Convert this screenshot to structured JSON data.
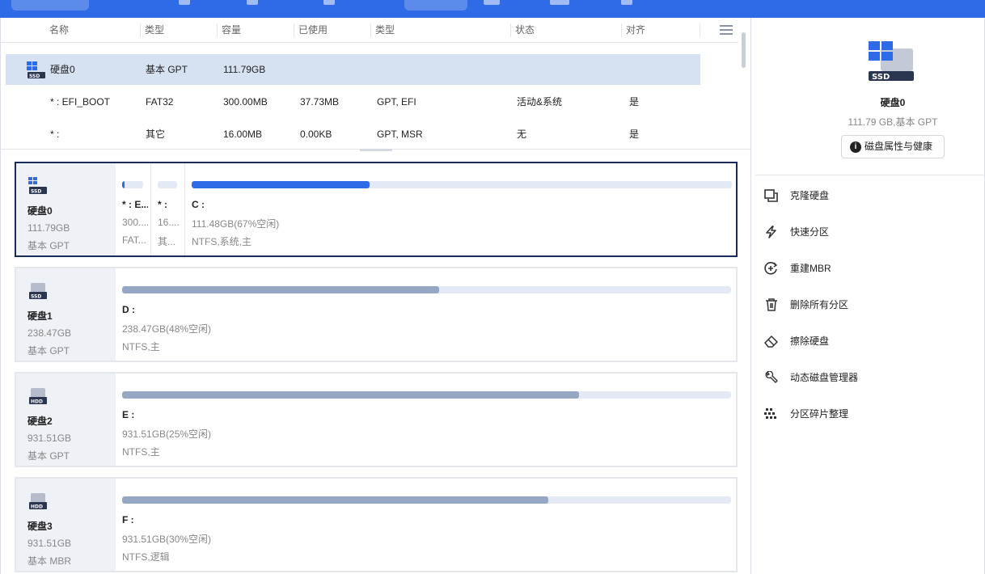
{
  "table": {
    "headers": [
      "名称",
      "类型",
      "容量",
      "已使用",
      "类型",
      "状态",
      "对齐"
    ],
    "rows": [
      {
        "name": "硬盘0",
        "type": "基本 GPT",
        "capacity": "111.79GB",
        "used": "",
        "fstype": "",
        "status": "",
        "align": ""
      },
      {
        "name": "* : EFI_BOOT",
        "type": "FAT32",
        "capacity": "300.00MB",
        "used": "37.73MB",
        "fstype": "GPT, EFI",
        "status": "活动&系统",
        "align": "是"
      },
      {
        "name": "* :",
        "type": "其它",
        "capacity": "16.00MB",
        "used": "0.00KB",
        "fstype": "GPT, MSR",
        "status": "无",
        "align": "是"
      }
    ]
  },
  "disks": [
    {
      "name": "硬盘0",
      "size": "111.79GB",
      "type": "基本 GPT",
      "icon": "ssd-icon",
      "partitions": [
        {
          "label": "* : E...",
          "info1": "300....",
          "info2": "FAT...",
          "fill": 0.12
        },
        {
          "label": "* :",
          "info1": "16....",
          "info2": "其...",
          "fill": 0.0
        },
        {
          "label": "C :",
          "info1": "111.48GB(67%空闲)",
          "info2": "NTFS,系统,主",
          "fill": 0.33
        }
      ]
    },
    {
      "name": "硬盘1",
      "size": "238.47GB",
      "type": "基本 GPT",
      "icon": "ssd-icon",
      "partitions": [
        {
          "label": "D :",
          "info1": "238.47GB(48%空闲)",
          "info2": "NTFS,主",
          "fill": 0.52
        }
      ]
    },
    {
      "name": "硬盘2",
      "size": "931.51GB",
      "type": "基本 GPT",
      "icon": "hdd-icon",
      "partitions": [
        {
          "label": "E :",
          "info1": "931.51GB(25%空闲)",
          "info2": "NTFS,主",
          "fill": 0.75
        }
      ]
    },
    {
      "name": "硬盘3",
      "size": "931.51GB",
      "type": "基本 MBR",
      "icon": "hdd-icon",
      "partitions": [
        {
          "label": "F :",
          "info1": "931.51GB(30%空闲)",
          "info2": "NTFS,逻辑",
          "fill": 0.7
        }
      ]
    }
  ],
  "right_panel": {
    "disk_name": "硬盘0",
    "disk_sub": "111.79 GB,基本 GPT",
    "props_button": "磁盘属性与健康",
    "actions": [
      {
        "label": "克隆硬盘",
        "icon": "clone-icon"
      },
      {
        "label": "快速分区",
        "icon": "lightning-icon"
      },
      {
        "label": "重建MBR",
        "icon": "rebuild-icon"
      },
      {
        "label": "删除所有分区",
        "icon": "trash-icon"
      },
      {
        "label": "擦除硬盘",
        "icon": "eraser-icon"
      },
      {
        "label": "动态磁盘管理器",
        "icon": "wrench-icon"
      },
      {
        "label": "分区碎片整理",
        "icon": "defrag-icon"
      }
    ]
  },
  "colors": {
    "accent": "#2f6be6",
    "used_active": "#2f6be6",
    "used_inactive": "#95a7c3",
    "selected_row": "#d6e1f1"
  }
}
